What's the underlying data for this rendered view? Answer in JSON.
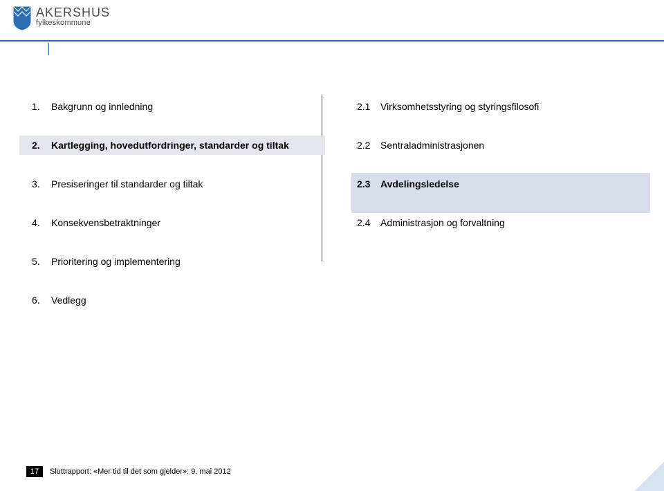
{
  "logo": {
    "title": "AKERSHUS",
    "sub": "fylkeskommune"
  },
  "left": [
    {
      "num": "1",
      "label": "Bakgrunn og innledning",
      "highlight": false
    },
    {
      "num": "2",
      "label": "Kartlegging, hovedutfordringer, standarder og tiltak",
      "highlight": true
    },
    {
      "num": "3",
      "label": "Presiseringer til standarder og tiltak",
      "highlight": false
    },
    {
      "num": "4",
      "label": "Konsekvensbetraktninger",
      "highlight": false
    },
    {
      "num": "5",
      "label": "Prioritering og implementering",
      "highlight": false
    },
    {
      "num": "6",
      "label": "Vedlegg",
      "highlight": false
    }
  ],
  "right": [
    {
      "num": "2.1",
      "label": "Virksomhetsstyring og styringsfilosofi",
      "highlight": false
    },
    {
      "num": "2.2",
      "label": "Sentraladministrasjonen",
      "highlight": false
    },
    {
      "num": "2.3",
      "label": "Avdelingsledelse",
      "highlight": true
    },
    {
      "num": "2.4",
      "label": "Administrasjon og forvaltning",
      "highlight": false
    }
  ],
  "footer": {
    "page": "17",
    "text": "Sluttrapport: «Mer tid til det som gjelder»: 9. mai 2012"
  }
}
